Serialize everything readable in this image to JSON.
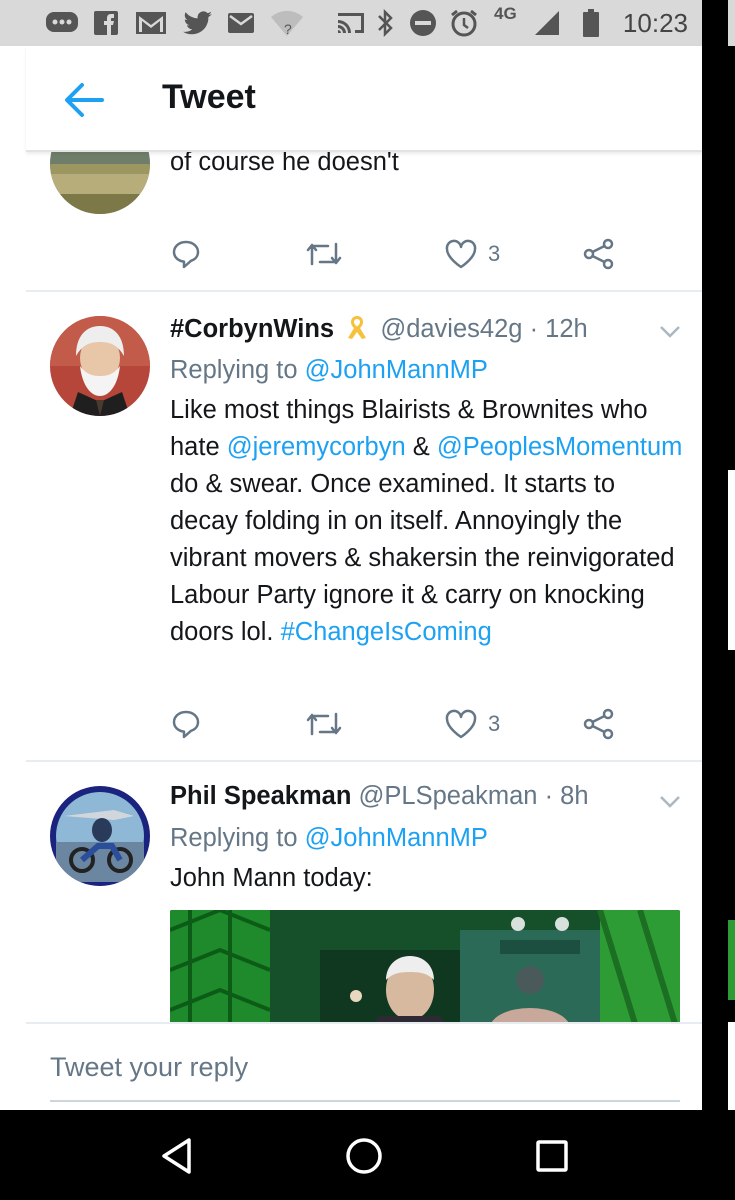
{
  "status_bar": {
    "time": "10:23",
    "network": "4G"
  },
  "app_bar": {
    "title": "Tweet"
  },
  "tweets": [
    {
      "text": "of course he doesn't",
      "likes": "3"
    },
    {
      "display_name": "#CorbynWins",
      "handle": "@davies42g",
      "time": "· 12h",
      "replying_prefix": "Replying to ",
      "replying_to": "@JohnMannMP",
      "text_parts": [
        "Like most things Blairists & Brownites who hate ",
        "@jeremycorbyn",
        " & ",
        "@PeoplesMomentum",
        " do & swear. Once examined. It starts to decay folding in on itself. Annoyingly the vibrant movers & shakersin the reinvigorated Labour Party ignore it & carry on knocking doors lol. ",
        "#ChangeIsComing"
      ],
      "likes": "3"
    },
    {
      "display_name": "Phil Speakman",
      "handle": "@PLSpeakman",
      "time": "· 8h",
      "replying_prefix": "Replying to ",
      "replying_to": "@JohnMannMP",
      "text": "John Mann today:"
    }
  ],
  "reply_bar": {
    "placeholder": "Tweet your reply"
  },
  "colors": {
    "accent": "#1da1f2",
    "text": "#14171a",
    "muted": "#657786"
  }
}
